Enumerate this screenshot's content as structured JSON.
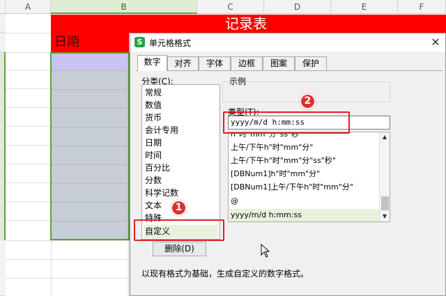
{
  "sheet": {
    "columns": [
      "A",
      "B",
      "C",
      "D",
      "E",
      "F"
    ],
    "selected_column": "B",
    "title": "记录表",
    "date_header": "日期"
  },
  "dialog": {
    "title": "单元格格式",
    "app_icon_letter": "S",
    "close_glyph": "✕",
    "tabs": [
      {
        "label": "数字",
        "active": true
      },
      {
        "label": "对齐",
        "active": false
      },
      {
        "label": "字体",
        "active": false
      },
      {
        "label": "边框",
        "active": false
      },
      {
        "label": "图案",
        "active": false
      },
      {
        "label": "保护",
        "active": false
      }
    ],
    "category_label": "分类(C):",
    "categories": [
      "常规",
      "数值",
      "货币",
      "会计专用",
      "日期",
      "时间",
      "百分比",
      "分数",
      "科学记数",
      "文本",
      "特殊",
      "自定义"
    ],
    "selected_category": "自定义",
    "preview_label": "示例",
    "type_label": "类型(T):",
    "type_value": "yyyy/m/d h:mm:ss",
    "format_options": [
      "h\"时\"mm\"分\"ss\"秒\"",
      "上午/下午h\"时\"mm\"分\"",
      "上午/下午h\"时\"mm\"分\"ss\"秒\"",
      "[DBNum1]h\"时\"mm\"分\"",
      "[DBNum1]上午/下午h\"时\"mm\"分\"",
      "@",
      "yyyy/m/d h:mm:ss"
    ],
    "selected_format": "yyyy/m/d h:mm:ss",
    "delete_button": "删除(D)",
    "description": "以现有格式为基础，生成自定义的数字格式。"
  },
  "annotations": {
    "marker_1": "1",
    "marker_2": "2",
    "color": "#e02020"
  },
  "colors": {
    "title_band": "#ff0000",
    "selection_border": "#5aa03c",
    "selected_item_bg": "#e8f1dc"
  }
}
